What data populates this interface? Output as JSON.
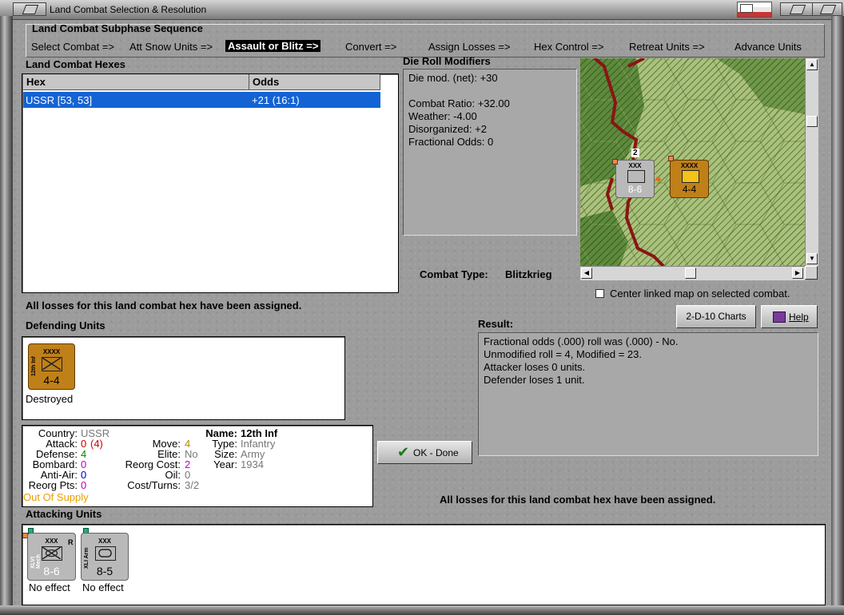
{
  "window": {
    "title": "Land Combat Selection & Resolution"
  },
  "subphase": {
    "title": "Land Combat Subphase Sequence",
    "steps": [
      "Select Combat =>",
      "Att Snow Units =>",
      "Assault or Blitz =>",
      "Convert =>",
      "Assign Losses =>",
      "Hex Control =>",
      "Retreat Units =>",
      "Advance Units"
    ],
    "active_index": 2
  },
  "hexes": {
    "title": "Land Combat Hexes",
    "columns": [
      "Hex",
      "Odds"
    ],
    "rows": [
      {
        "hex": "USSR [53, 53]",
        "odds": "+21 (16:1)",
        "selected": true
      }
    ]
  },
  "modifiers": {
    "title": "Die Roll Modifiers",
    "lines": [
      "Die mod. (net): +30",
      "",
      "Combat Ratio: +32.00",
      "Weather: -4.00",
      "Disorganized: +2",
      "Fractional Odds: 0"
    ]
  },
  "combat_type": {
    "label": "Combat Type:",
    "value": "Blitzkrieg"
  },
  "center_map": {
    "label": "Center linked map on selected combat.",
    "checked": false
  },
  "buttons": {
    "charts": "2-D-10 Charts",
    "help": "Help",
    "ok": "OK - Done"
  },
  "losses_msg": "All losses for this land combat hex have been assigned.",
  "defending": {
    "title": "Defending Units",
    "units": [
      {
        "size": "XXXX",
        "name": "12th Inf",
        "strength": "4-4",
        "color": "#c08019",
        "status": "Destroyed"
      }
    ]
  },
  "result": {
    "title": "Result:",
    "lines": [
      "Fractional odds (.000) roll was (.000)  - No.",
      "Unmodified roll = 4, Modified = 23.",
      "Attacker loses 0 units.",
      "Defender loses 1 unit."
    ]
  },
  "unit_info": {
    "country": {
      "label": "Country:",
      "value": "USSR"
    },
    "attack": {
      "label": "Attack:",
      "value": "0",
      "extra": "(4)"
    },
    "defense": {
      "label": "Defense:",
      "value": "4"
    },
    "bombard": {
      "label": "Bombard:",
      "value": "0"
    },
    "anti_air": {
      "label": "Anti-Air:",
      "value": "0"
    },
    "reorg_pts": {
      "label": "Reorg Pts:",
      "value": "0"
    },
    "supply": "Out Of Supply",
    "move": {
      "label": "Move:",
      "value": "4"
    },
    "elite": {
      "label": "Elite:",
      "value": "No"
    },
    "reorg_cost": {
      "label": "Reorg Cost:",
      "value": "2"
    },
    "oil": {
      "label": "Oil:",
      "value": "0"
    },
    "cost_turns": {
      "label": "Cost/Turns:",
      "value": "3/2"
    },
    "name": {
      "label": "Name:",
      "value": "12th Inf"
    },
    "type": {
      "label": "Type:",
      "value": "Infantry"
    },
    "size": {
      "label": "Size:",
      "value": "Army"
    },
    "year": {
      "label": "Year:",
      "value": "1934"
    }
  },
  "attacking": {
    "title": "Attacking Units",
    "units": [
      {
        "size": "XXX",
        "name": "XLVI Mech",
        "strength": "8-6",
        "flag": "R",
        "status": "No effect"
      },
      {
        "size": "XXX",
        "name": "XLI Arm",
        "strength": "8-5",
        "flag": "",
        "status": "No effect"
      }
    ]
  },
  "map": {
    "stack_count": "2",
    "attacker": {
      "size": "XXX",
      "strength": "8-6"
    },
    "defender": {
      "size": "XXXX",
      "strength": "4-4"
    }
  },
  "colors": {
    "selection": "#1463d4",
    "brown_counter": "#c08019",
    "gray_counter": "#b9b9b9",
    "supply": "#e8a000",
    "attack_red": "#d00000",
    "defense_green": "#008800",
    "bombard_magenta": "#c000c0",
    "aa_blue": "#0000c0"
  }
}
